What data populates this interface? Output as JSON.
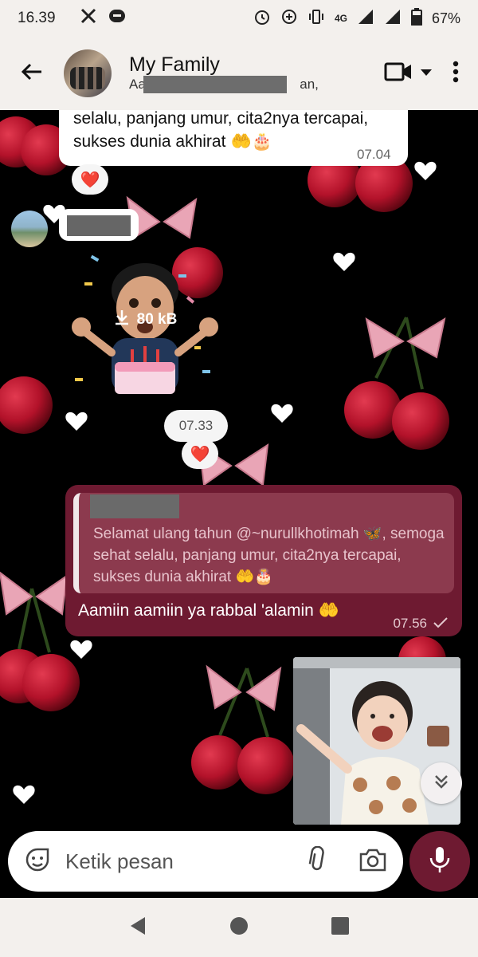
{
  "status_bar": {
    "time": "16.39",
    "network": "4G",
    "battery": "67%"
  },
  "header": {
    "title": "My Family",
    "subtitle_start": "Aa",
    "subtitle_end": "an, ..."
  },
  "messages": {
    "incoming_1": {
      "line1": "selalu, panjang umur, cita2nya tercapai,",
      "line2": "sukses dunia akhirat",
      "emoji": "🤲🎂",
      "time": "07.04",
      "reaction": "❤️"
    },
    "sticker": {
      "download_size": "80 kB",
      "time": "07.33",
      "reaction": "❤️"
    },
    "outgoing_1": {
      "quote_text": "Selamat ulang tahun @~nurullkhotimah 🦋, semoga sehat selalu, panjang umur, cita2nya tercapai, sukses dunia akhirat 🤲🎂",
      "text": "Aamiin aamiin ya rabbal 'alamin 🤲",
      "time": "07.56"
    }
  },
  "composer": {
    "placeholder": "Ketik pesan"
  },
  "icons": {
    "status": [
      "x-icon",
      "message-icon",
      "alarm-icon",
      "data-saver-icon",
      "vibrate-icon",
      "signal-icon",
      "battery-icon"
    ],
    "header": [
      "back-arrow-icon",
      "video-call-icon",
      "dropdown-icon",
      "more-vert-icon"
    ],
    "composer": [
      "sticker-icon",
      "attach-icon",
      "camera-icon",
      "mic-icon"
    ],
    "nav": [
      "nav-back-icon",
      "nav-home-icon",
      "nav-recents-icon"
    ]
  },
  "colors": {
    "accent": "#6e1a31",
    "bar_bg": "#f3f0ed",
    "chat_bg": "#000000",
    "cherry": "#b3122a",
    "bow": "#e9a5b6"
  }
}
